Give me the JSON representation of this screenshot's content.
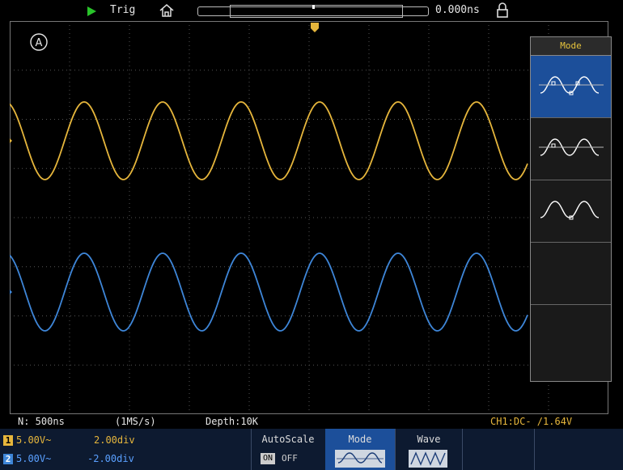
{
  "topbar": {
    "trigger_state": "Trig",
    "timebase_position": "0.000ns"
  },
  "screen": {
    "marker_a": "A",
    "ch1_marker": "1",
    "ch2_marker": "2",
    "trigger_marker": "T"
  },
  "mode_menu": {
    "title": "Mode",
    "options": [
      "mode-1",
      "mode-2",
      "mode-3",
      "",
      ""
    ],
    "selected_index": 0
  },
  "status": {
    "record_points": "N: 500ns",
    "sample_rate": "(1MS/s)",
    "depth": "Depth:10K",
    "trigger_info": "CH1:DC- /1.64V"
  },
  "channels": [
    {
      "id": "1",
      "volts": "5.00V~",
      "offset": "2.00div"
    },
    {
      "id": "2",
      "volts": "5.00V~",
      "offset": "-2.00div"
    }
  ],
  "softkeys": {
    "autoscale_label": "AutoScale",
    "autoscale_on": "ON",
    "autoscale_off": "OFF",
    "mode_label": "Mode",
    "wave_label": "Wave"
  },
  "colors": {
    "ch1": "#e6b63c",
    "ch2": "#3e86d8",
    "accent": "#1c4f9a"
  }
}
